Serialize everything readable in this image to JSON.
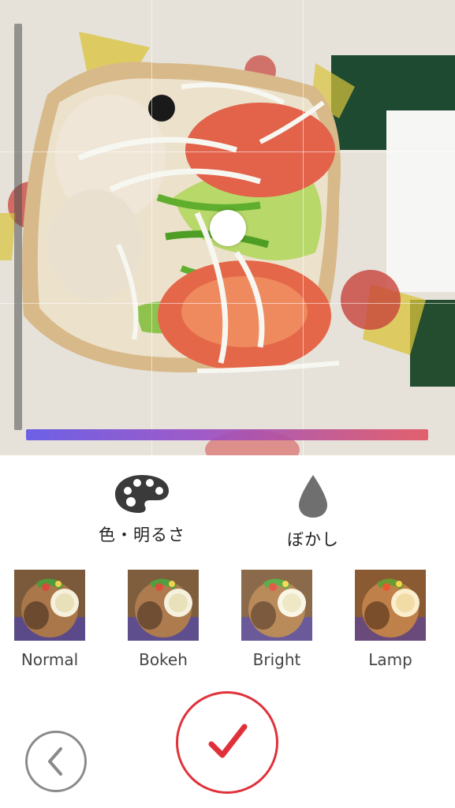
{
  "editor": {
    "modes": [
      {
        "id": "color",
        "label": "色・明るさ",
        "icon": "palette-icon"
      },
      {
        "id": "blur",
        "label": "ぼかし",
        "icon": "drop-icon"
      }
    ],
    "filters": [
      {
        "id": "normal",
        "label": "Normal"
      },
      {
        "id": "bokeh",
        "label": "Bokeh"
      },
      {
        "id": "bright",
        "label": "Bright"
      },
      {
        "id": "lamp",
        "label": "Lamp"
      }
    ],
    "gradient_colors": [
      "#6255e6",
      "#9b4fc4",
      "#e25563"
    ],
    "accent_color": "#e0313a",
    "back_icon": "chevron-left-icon",
    "confirm_icon": "checkmark-icon"
  }
}
